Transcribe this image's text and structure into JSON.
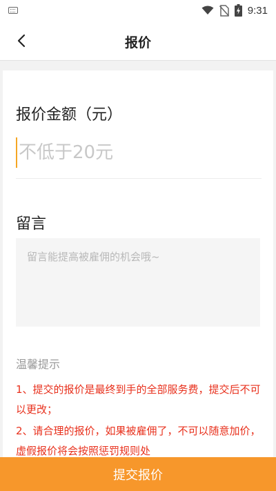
{
  "status_bar": {
    "time": "9:31",
    "icons": [
      "keyboard-icon",
      "wifi-icon",
      "no-sim-icon",
      "battery-charging-icon"
    ]
  },
  "header": {
    "back_icon": "chevron-left-icon",
    "title": "报价"
  },
  "form": {
    "amount_label": "报价金额（元）",
    "amount_value": "",
    "amount_placeholder": "不低于20元",
    "message_label": "留言",
    "message_value": "",
    "message_placeholder": "留言能提高被雇佣的机会哦~"
  },
  "tips": {
    "title": "温馨提示",
    "items": [
      "1、提交的报价是最终到手的全部服务费，提交后不可以更改；",
      "2、请合理的报价，如果被雇佣了，不可以随意加价，虚假报价将会按照惩罚规则处"
    ]
  },
  "submit": {
    "label": "提交报价"
  },
  "colors": {
    "accent": "#f7972b",
    "caret": "#f5a623",
    "warning_text": "#e8301c",
    "background": "#f2f2f2"
  }
}
